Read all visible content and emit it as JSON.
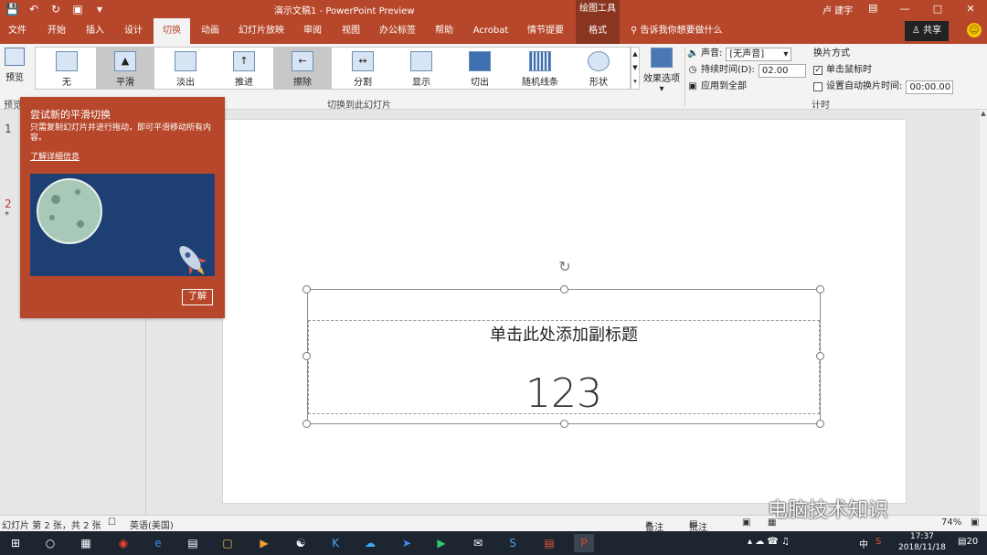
{
  "titlebar": {
    "document_title": "演示文稿1  -  PowerPoint Preview",
    "context_group": "绘图工具",
    "user": "卢 建宇"
  },
  "tabs": [
    {
      "label": "文件"
    },
    {
      "label": "开始"
    },
    {
      "label": "插入"
    },
    {
      "label": "设计"
    },
    {
      "label": "切换"
    },
    {
      "label": "动画"
    },
    {
      "label": "幻灯片放映"
    },
    {
      "label": "审阅"
    },
    {
      "label": "视图"
    },
    {
      "label": "办公标签"
    },
    {
      "label": "帮助"
    },
    {
      "label": "Acrobat"
    },
    {
      "label": "情节提要"
    },
    {
      "label": "格式"
    }
  ],
  "tell_me": "告诉我你想要做什么",
  "share_label": "共享",
  "ribbon": {
    "preview_label": "预览",
    "preview_group": "预览",
    "gallery": [
      {
        "label": "无"
      },
      {
        "label": "平滑"
      },
      {
        "label": "淡出"
      },
      {
        "label": "推进"
      },
      {
        "label": "擦除"
      },
      {
        "label": "分割"
      },
      {
        "label": "显示"
      },
      {
        "label": "切出"
      },
      {
        "label": "随机线条"
      },
      {
        "label": "形状"
      }
    ],
    "effect_options": "效果选项",
    "transition_group": "切换到此幻灯片",
    "timing": {
      "sound_label": "声音:",
      "sound_value": "[无声音]",
      "duration_label": "持续时间(D):",
      "duration_value": "02.00",
      "apply_all": "应用到全部"
    },
    "advance": {
      "title": "换片方式",
      "on_click": "单击鼠标时",
      "after_time": "设置自动换片时间:",
      "after_value": "00:00.00"
    },
    "timing_group": "计时"
  },
  "slides_panel": {
    "slide1_num": "1",
    "slide2_num": "2",
    "slide2_star": "*"
  },
  "popup": {
    "title": "尝试新的平滑切换",
    "body": "只需复制幻灯片并进行拖动，即可平滑移动所有内容。",
    "link": "了解详细信息",
    "button": "了解"
  },
  "slide": {
    "subtitle": "单击此处添加副标题",
    "number": "123"
  },
  "statusbar": {
    "slide_info": "幻灯片 第 2 张，共 2 张",
    "language": "英语(美国)",
    "notes": "备注",
    "comments": "批注",
    "zoom": "74%"
  },
  "watermark": "电脑技术知识",
  "taskbar": {
    "time": "17:37",
    "date": "2018/11/18",
    "ime": "中",
    "notification_count": "20"
  }
}
